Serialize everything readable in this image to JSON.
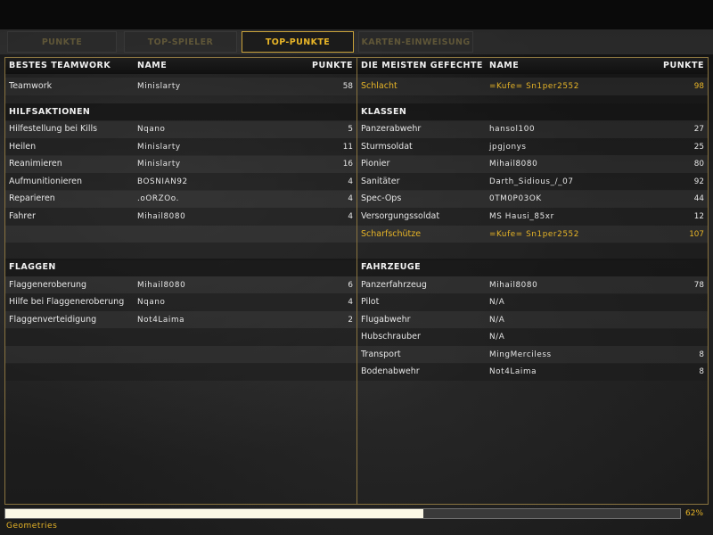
{
  "tabs": [
    {
      "label": "PUNKTE",
      "active": false
    },
    {
      "label": "TOP-SPIELER",
      "active": false
    },
    {
      "label": "TOP-PUNKTE",
      "active": true
    },
    {
      "label": "KARTEN-EINWEISUNG",
      "active": false
    }
  ],
  "left": {
    "header": {
      "title": "BESTES TEAMWORK",
      "name": "NAME",
      "points": "PUNKTE"
    },
    "top_rows": [
      {
        "label": "Teamwork",
        "name": "Minislarty",
        "points": "58"
      }
    ],
    "sections": [
      {
        "title": "HILFSAKTIONEN",
        "rows": [
          {
            "label": "Hilfestellung bei Kills",
            "name": "Nqano",
            "points": "5"
          },
          {
            "label": "Heilen",
            "name": "Minislarty",
            "points": "11"
          },
          {
            "label": "Reanimieren",
            "name": "Minislarty",
            "points": "16"
          },
          {
            "label": "Aufmunitionieren",
            "name": "BOSNIAN92",
            "points": "4"
          },
          {
            "label": "Reparieren",
            "name": ".oORZOo.",
            "points": "4"
          },
          {
            "label": "Fahrer",
            "name": "Mihail8080",
            "points": "4"
          }
        ]
      },
      {
        "title": "FLAGGEN",
        "rows": [
          {
            "label": "Flaggeneroberung",
            "name": "Mihail8080",
            "points": "6"
          },
          {
            "label": "Hilfe bei Flaggeneroberung",
            "name": "Nqano",
            "points": "4"
          },
          {
            "label": "Flaggenverteidigung",
            "name": "Not4Laima",
            "points": "2"
          }
        ]
      }
    ]
  },
  "right": {
    "header": {
      "title": "DIE MEISTEN GEFECHTE",
      "name": "NAME",
      "points": "PUNKTE"
    },
    "top_rows": [
      {
        "label": "Schlacht",
        "name": "=Kufe= Sn1per2552",
        "points": "98",
        "highlight": true
      }
    ],
    "sections": [
      {
        "title": "KLASSEN",
        "rows": [
          {
            "label": "Panzerabwehr",
            "name": "hansol100",
            "points": "27"
          },
          {
            "label": "Sturmsoldat",
            "name": "jpgjonys",
            "points": "25"
          },
          {
            "label": "Pionier",
            "name": "Mihail8080",
            "points": "80"
          },
          {
            "label": "Sanitäter",
            "name": "Darth_Sidious_/_07",
            "points": "92"
          },
          {
            "label": "Spec-Ops",
            "name": "0TM0P03OK",
            "points": "44"
          },
          {
            "label": "Versorgungssoldat",
            "name": "MS Hausi_85xr",
            "points": "12"
          },
          {
            "label": "Scharfschütze",
            "name": "=Kufe= Sn1per2552",
            "points": "107",
            "highlight": true
          }
        ]
      },
      {
        "title": "FAHRZEUGE",
        "rows": [
          {
            "label": "Panzerfahrzeug",
            "name": "Mihail8080",
            "points": "78"
          },
          {
            "label": "Pilot",
            "name": "N/A",
            "points": ""
          },
          {
            "label": "Flugabwehr",
            "name": "N/A",
            "points": ""
          },
          {
            "label": "Hubschrauber",
            "name": "N/A",
            "points": ""
          },
          {
            "label": "Transport",
            "name": "MingMerciless",
            "points": "8"
          },
          {
            "label": "Bodenabwehr",
            "name": "Not4Laima",
            "points": "8"
          }
        ]
      }
    ]
  },
  "loading": {
    "progress_percent": 62,
    "percent_label": "62%",
    "status": "Geometries"
  },
  "colors": {
    "accent": "#e8b527",
    "border": "#8a7440",
    "text": "#e6e6e6"
  }
}
